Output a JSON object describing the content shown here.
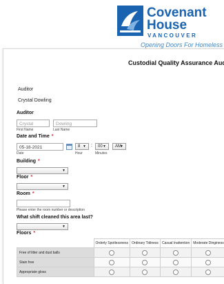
{
  "branding": {
    "line1": "Covenant",
    "line2": "House",
    "line3": "VANCOUVER",
    "tagline": "Opening Doors For Homeless Y",
    "color": "#1a63b0"
  },
  "form": {
    "title": "Custodial Quality Assurance Audit",
    "auditor_heading": "Auditor",
    "auditor_name": "Crystal Dowling",
    "auditor_section": {
      "label": "Auditor",
      "first_placeholder": "Crystal",
      "last_placeholder": "Dowling",
      "first_sub": "First Name",
      "last_sub": "Last Name"
    },
    "date_time": {
      "label": "Date and Time",
      "required": "*",
      "date_value": "05-18-2021",
      "date_sub": "Date",
      "hour_value": "8",
      "minute_value": "00",
      "ampm_value": "AM",
      "colon": ":",
      "hour_sub": "Hour",
      "minute_sub": "Minutes"
    },
    "building": {
      "label": "Building",
      "required": "*"
    },
    "floor": {
      "label": "Floor",
      "required": "*"
    },
    "room": {
      "label": "Room",
      "required": "*",
      "hint": "Please enter the room number or description"
    },
    "shift": {
      "label": "What shift cleaned this area last?"
    },
    "floors": {
      "label": "Floors",
      "required": "*",
      "columns": [
        "Orderly Spotlessness",
        "Ordinary Tidiness",
        "Casual Inattention",
        "Moderate Dinginess"
      ],
      "rows": [
        "Free of litter and dust balls",
        "Stain free",
        "Appropriate gloss"
      ]
    }
  },
  "icons": {
    "calendar": "calendar-icon",
    "dropdown": "chevron-down-icon"
  }
}
